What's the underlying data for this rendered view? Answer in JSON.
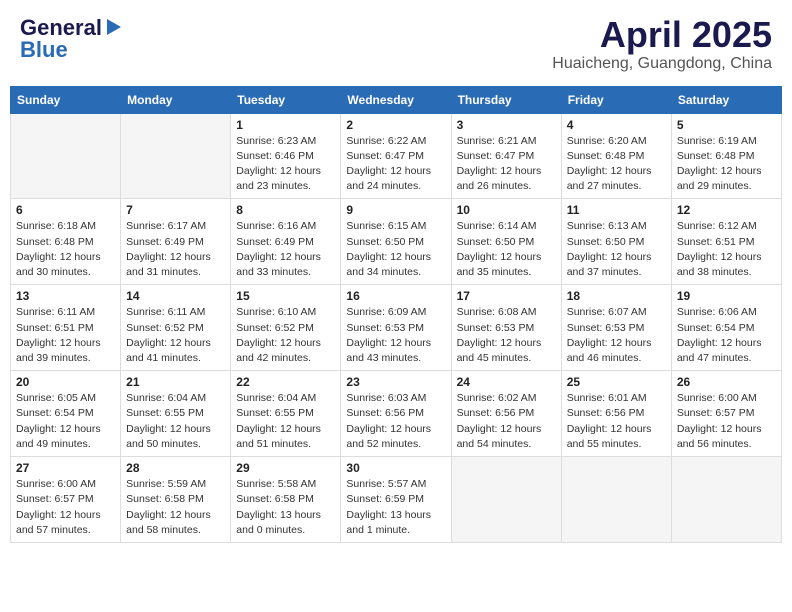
{
  "header": {
    "logo_general": "General",
    "logo_blue": "Blue",
    "title": "April 2025",
    "location": "Huaicheng, Guangdong, China"
  },
  "weekdays": [
    "Sunday",
    "Monday",
    "Tuesday",
    "Wednesday",
    "Thursday",
    "Friday",
    "Saturday"
  ],
  "weeks": [
    [
      {
        "day": "",
        "sunrise": "",
        "sunset": "",
        "daylight": ""
      },
      {
        "day": "",
        "sunrise": "",
        "sunset": "",
        "daylight": ""
      },
      {
        "day": "1",
        "sunrise": "Sunrise: 6:23 AM",
        "sunset": "Sunset: 6:46 PM",
        "daylight": "Daylight: 12 hours and 23 minutes."
      },
      {
        "day": "2",
        "sunrise": "Sunrise: 6:22 AM",
        "sunset": "Sunset: 6:47 PM",
        "daylight": "Daylight: 12 hours and 24 minutes."
      },
      {
        "day": "3",
        "sunrise": "Sunrise: 6:21 AM",
        "sunset": "Sunset: 6:47 PM",
        "daylight": "Daylight: 12 hours and 26 minutes."
      },
      {
        "day": "4",
        "sunrise": "Sunrise: 6:20 AM",
        "sunset": "Sunset: 6:48 PM",
        "daylight": "Daylight: 12 hours and 27 minutes."
      },
      {
        "day": "5",
        "sunrise": "Sunrise: 6:19 AM",
        "sunset": "Sunset: 6:48 PM",
        "daylight": "Daylight: 12 hours and 29 minutes."
      }
    ],
    [
      {
        "day": "6",
        "sunrise": "Sunrise: 6:18 AM",
        "sunset": "Sunset: 6:48 PM",
        "daylight": "Daylight: 12 hours and 30 minutes."
      },
      {
        "day": "7",
        "sunrise": "Sunrise: 6:17 AM",
        "sunset": "Sunset: 6:49 PM",
        "daylight": "Daylight: 12 hours and 31 minutes."
      },
      {
        "day": "8",
        "sunrise": "Sunrise: 6:16 AM",
        "sunset": "Sunset: 6:49 PM",
        "daylight": "Daylight: 12 hours and 33 minutes."
      },
      {
        "day": "9",
        "sunrise": "Sunrise: 6:15 AM",
        "sunset": "Sunset: 6:50 PM",
        "daylight": "Daylight: 12 hours and 34 minutes."
      },
      {
        "day": "10",
        "sunrise": "Sunrise: 6:14 AM",
        "sunset": "Sunset: 6:50 PM",
        "daylight": "Daylight: 12 hours and 35 minutes."
      },
      {
        "day": "11",
        "sunrise": "Sunrise: 6:13 AM",
        "sunset": "Sunset: 6:50 PM",
        "daylight": "Daylight: 12 hours and 37 minutes."
      },
      {
        "day": "12",
        "sunrise": "Sunrise: 6:12 AM",
        "sunset": "Sunset: 6:51 PM",
        "daylight": "Daylight: 12 hours and 38 minutes."
      }
    ],
    [
      {
        "day": "13",
        "sunrise": "Sunrise: 6:11 AM",
        "sunset": "Sunset: 6:51 PM",
        "daylight": "Daylight: 12 hours and 39 minutes."
      },
      {
        "day": "14",
        "sunrise": "Sunrise: 6:11 AM",
        "sunset": "Sunset: 6:52 PM",
        "daylight": "Daylight: 12 hours and 41 minutes."
      },
      {
        "day": "15",
        "sunrise": "Sunrise: 6:10 AM",
        "sunset": "Sunset: 6:52 PM",
        "daylight": "Daylight: 12 hours and 42 minutes."
      },
      {
        "day": "16",
        "sunrise": "Sunrise: 6:09 AM",
        "sunset": "Sunset: 6:53 PM",
        "daylight": "Daylight: 12 hours and 43 minutes."
      },
      {
        "day": "17",
        "sunrise": "Sunrise: 6:08 AM",
        "sunset": "Sunset: 6:53 PM",
        "daylight": "Daylight: 12 hours and 45 minutes."
      },
      {
        "day": "18",
        "sunrise": "Sunrise: 6:07 AM",
        "sunset": "Sunset: 6:53 PM",
        "daylight": "Daylight: 12 hours and 46 minutes."
      },
      {
        "day": "19",
        "sunrise": "Sunrise: 6:06 AM",
        "sunset": "Sunset: 6:54 PM",
        "daylight": "Daylight: 12 hours and 47 minutes."
      }
    ],
    [
      {
        "day": "20",
        "sunrise": "Sunrise: 6:05 AM",
        "sunset": "Sunset: 6:54 PM",
        "daylight": "Daylight: 12 hours and 49 minutes."
      },
      {
        "day": "21",
        "sunrise": "Sunrise: 6:04 AM",
        "sunset": "Sunset: 6:55 PM",
        "daylight": "Daylight: 12 hours and 50 minutes."
      },
      {
        "day": "22",
        "sunrise": "Sunrise: 6:04 AM",
        "sunset": "Sunset: 6:55 PM",
        "daylight": "Daylight: 12 hours and 51 minutes."
      },
      {
        "day": "23",
        "sunrise": "Sunrise: 6:03 AM",
        "sunset": "Sunset: 6:56 PM",
        "daylight": "Daylight: 12 hours and 52 minutes."
      },
      {
        "day": "24",
        "sunrise": "Sunrise: 6:02 AM",
        "sunset": "Sunset: 6:56 PM",
        "daylight": "Daylight: 12 hours and 54 minutes."
      },
      {
        "day": "25",
        "sunrise": "Sunrise: 6:01 AM",
        "sunset": "Sunset: 6:56 PM",
        "daylight": "Daylight: 12 hours and 55 minutes."
      },
      {
        "day": "26",
        "sunrise": "Sunrise: 6:00 AM",
        "sunset": "Sunset: 6:57 PM",
        "daylight": "Daylight: 12 hours and 56 minutes."
      }
    ],
    [
      {
        "day": "27",
        "sunrise": "Sunrise: 6:00 AM",
        "sunset": "Sunset: 6:57 PM",
        "daylight": "Daylight: 12 hours and 57 minutes."
      },
      {
        "day": "28",
        "sunrise": "Sunrise: 5:59 AM",
        "sunset": "Sunset: 6:58 PM",
        "daylight": "Daylight: 12 hours and 58 minutes."
      },
      {
        "day": "29",
        "sunrise": "Sunrise: 5:58 AM",
        "sunset": "Sunset: 6:58 PM",
        "daylight": "Daylight: 13 hours and 0 minutes."
      },
      {
        "day": "30",
        "sunrise": "Sunrise: 5:57 AM",
        "sunset": "Sunset: 6:59 PM",
        "daylight": "Daylight: 13 hours and 1 minute."
      },
      {
        "day": "",
        "sunrise": "",
        "sunset": "",
        "daylight": ""
      },
      {
        "day": "",
        "sunrise": "",
        "sunset": "",
        "daylight": ""
      },
      {
        "day": "",
        "sunrise": "",
        "sunset": "",
        "daylight": ""
      }
    ]
  ]
}
